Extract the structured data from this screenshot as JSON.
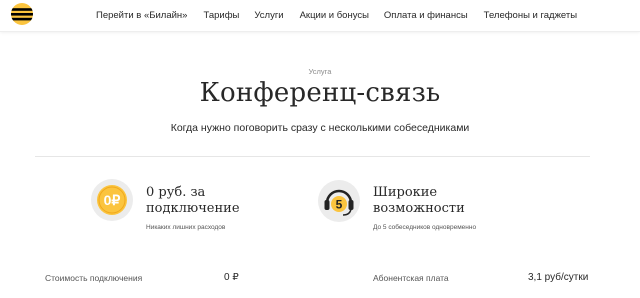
{
  "header": {
    "logo_icon": "beeline-logo-icon",
    "brand_colors": {
      "yellow": "#fbc43e",
      "black": "#000000"
    },
    "nav": [
      "Перейти в «Билайн»",
      "Тарифы",
      "Услуги",
      "Акции и бонусы",
      "Оплата и финансы",
      "Телефоны и гаджеты"
    ]
  },
  "hero": {
    "eyebrow": "Услуга",
    "title": "Конференц-связь",
    "subtitle": "Когда нужно поговорить сразу с несколькими собеседниками"
  },
  "features": [
    {
      "icon": "zero-ruble-coin-icon",
      "icon_text": "0₽",
      "title_line1": "0 руб. за",
      "title_line2": "подключение",
      "note": "Никаких лишних расходов"
    },
    {
      "icon": "headset-icon",
      "icon_text": "5",
      "title_line1": "Широкие",
      "title_line2": "возможности",
      "note": "До 5 собеседников одновременно"
    }
  ],
  "pricing": {
    "connection_label": "Стоимость подключения",
    "connection_value": "0 ₽",
    "fee_label": "Абонентская плата",
    "fee_value": "3,1 руб/сутки"
  }
}
